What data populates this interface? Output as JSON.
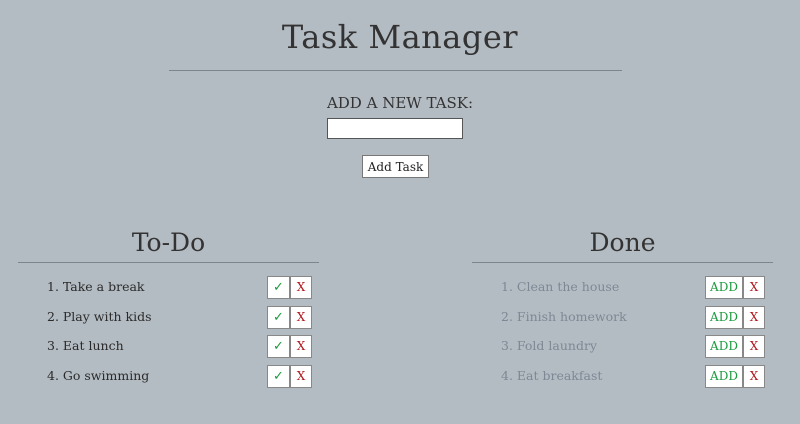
{
  "app": {
    "title": "Task Manager"
  },
  "add_task": {
    "label": "ADD A NEW TASK:",
    "input_value": "",
    "placeholder": "",
    "button_label": "Add Task"
  },
  "todo": {
    "heading": "To-Do",
    "complete_label": "✓",
    "delete_label": "X",
    "items": [
      {
        "text": "1. Take a break"
      },
      {
        "text": "2. Play with kids"
      },
      {
        "text": "3. Eat lunch"
      },
      {
        "text": "4. Go swimming"
      }
    ]
  },
  "done": {
    "heading": "Done",
    "readd_label": "ADD",
    "delete_label": "X",
    "items": [
      {
        "text": "1. Clean the house"
      },
      {
        "text": "2. Finish homework"
      },
      {
        "text": "3. Fold laundry"
      },
      {
        "text": "4. Eat breakfast"
      }
    ]
  },
  "colors": {
    "background": "#b4bcc3",
    "check": "#1a9a3c",
    "delete": "#b0181d",
    "done_text": "#7d8894"
  }
}
